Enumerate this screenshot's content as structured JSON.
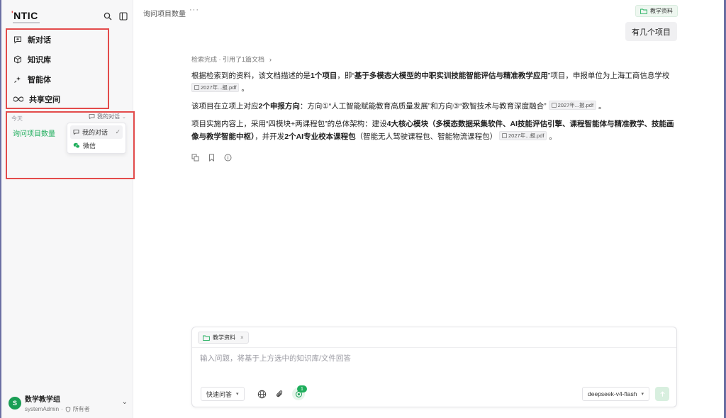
{
  "app": {
    "logo": "NTIC"
  },
  "sidebar": {
    "nav": [
      {
        "label": "新对话",
        "icon": "new-chat-icon"
      },
      {
        "label": "知识库",
        "icon": "knowledge-base-icon"
      },
      {
        "label": "智能体",
        "icon": "agent-sparkle-icon"
      },
      {
        "label": "共享空间",
        "icon": "infinity-icon"
      }
    ],
    "today_label": "今天",
    "filter_label": "我的对话",
    "conversation": "询问项目数量",
    "dropdown": [
      {
        "label": "我的对话",
        "selected": true
      },
      {
        "label": "微信",
        "selected": false
      }
    ],
    "user": {
      "avatar": "S",
      "name": "数学教学组",
      "account": "systemAdmin",
      "role": "所有者"
    }
  },
  "header": {
    "title": "询问项目数量",
    "more": "···",
    "kb_chip": "教学资料"
  },
  "chat": {
    "user_question": "有几个项目",
    "retrieval": "检索完成 · 引用了1篇文档",
    "p1": {
      "t1": "根据检索到的资料，该文档描述的是",
      "b1": "1个项目",
      "t2": "，即“",
      "b2": "基于多模态大模型的中职实训技能智能评估与精准教学应用",
      "t3": "”项目，申报单位为上海工商信息学校",
      "cite": "2027年...报.pdf",
      "end": "。"
    },
    "p2": {
      "t1": "该项目在立项上对应",
      "b1": "2个申报方向",
      "t2": "：方向①“人工智能赋能教育高质量发展”和方向③“数智技术与教育深度融合”",
      "cite": "2027年...报.pdf",
      "end": "。"
    },
    "p3": {
      "t1": "项目实施内容上，采用“四模块+两课程包”的总体架构：建设",
      "b1": "4大核心模块（多模态数据采集软件、AI技能评估引擎、课程智能体与精准教学、技能画像与教学智能中枢）",
      "t2": "，并开发",
      "b2": "2个AI专业校本课程包",
      "t3": "（智能无人驾驶课程包、智能物流课程包）",
      "cite": "2027年...报.pdf",
      "end": "。"
    }
  },
  "composer": {
    "attachment": "教学资料",
    "placeholder": "输入问题，将基于上方选中的知识库/文件回答",
    "mode": "快速问答",
    "kb_count": "1",
    "model": "deepseek-v4-flash"
  },
  "colors": {
    "accent": "#1fae5c",
    "highlight_box": "#e34b4b",
    "frame": "#6b6fa3"
  }
}
